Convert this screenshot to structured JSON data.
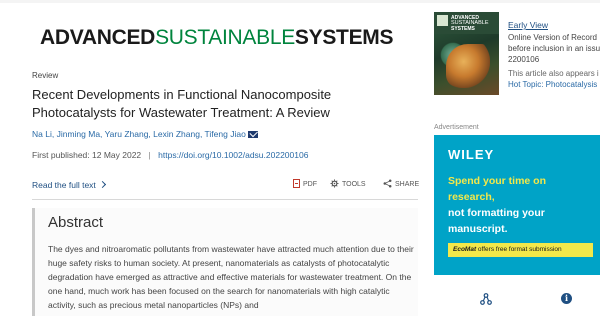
{
  "journal": {
    "logo_part1": "ADVANCED",
    "logo_part2": "SUSTAINABLE",
    "logo_part3": "SYSTEMS"
  },
  "article": {
    "type": "Review",
    "title": "Recent Developments in Functional Nanocomposite Photocatalysts for Wastewater Treatment: A Review",
    "authors": [
      "Na Li,",
      "Jinming Ma,",
      "Yaru Zhang,",
      "Lexin Zhang,",
      "Tifeng Jiao"
    ],
    "first_published_label": "First published:",
    "first_published_date": "12 May 2022",
    "separator": "|",
    "doi": "https://doi.org/10.1002/adsu.202200106"
  },
  "actions": {
    "read_full_text": "Read the full text",
    "pdf": "PDF",
    "tools": "TOOLS",
    "share": "SHARE"
  },
  "abstract": {
    "heading": "Abstract",
    "body": "The dyes and nitroaromatic pollutants from wastewater have attracted much attention due to their huge safety risks to human society. At present, nanomaterials as catalysts of photocatalytic degradation have emerged as attractive and effective materials for wastewater treatment. On the one hand, much work has been focused on the search for nanomaterials with high catalytic activity, such as precious metal nanoparticles (NPs) and"
  },
  "sidebar": {
    "cover_line1": "ADVANCED",
    "cover_line2": "SUSTAINABLE",
    "cover_line3": "SYSTEMS",
    "early_view_link": "Early View",
    "early_view_text_line1": "Online Version of Record",
    "early_view_text_line2": "before inclusion in an issu",
    "article_number": "2200106",
    "appears_in": "This article also appears i",
    "hot_topic": "Hot Topic: Photocatalysis"
  },
  "advertisement": {
    "label": "Advertisement",
    "brand": "WILEY",
    "headline_line1": "Spend your time on",
    "headline_line2": "research,",
    "subline_line1": "not formatting your",
    "subline_line2": "manuscript.",
    "cta_journal": "EcoMat",
    "cta_text": " offers free format submission"
  },
  "colors": {
    "brand_green": "#00843d",
    "link_blue": "#2a6aa6",
    "ad_background": "#00a3c7",
    "ad_yellow": "#f3e84a"
  }
}
